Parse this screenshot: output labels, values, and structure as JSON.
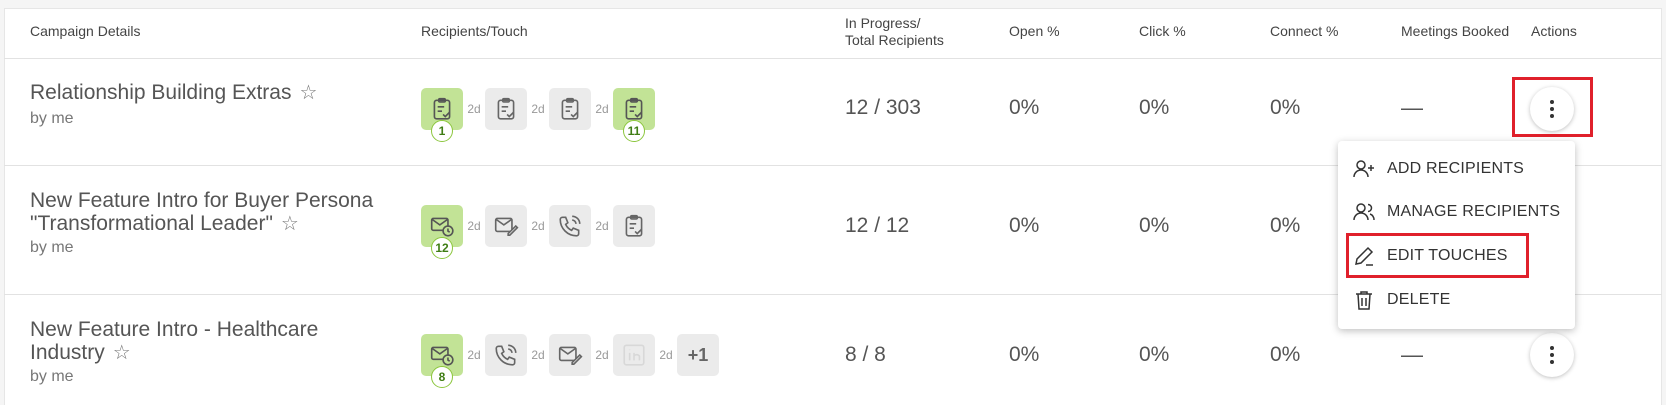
{
  "headers": {
    "campaign": "Campaign Details",
    "recipients_touch": "Recipients/Touch",
    "in_progress_line1": "In Progress/",
    "in_progress_line2": "Total Recipients",
    "open": "Open %",
    "click": "Click %",
    "connect": "Connect %",
    "meetings": "Meetings Booked",
    "actions": "Actions"
  },
  "rows": [
    {
      "name_line1": "Relationship Building Extras",
      "name_line2": "",
      "by": "by me",
      "star": "☆",
      "in_progress": "12 / 303",
      "open": "0%",
      "click": "0%",
      "connect": "0%",
      "meetings": "—",
      "touches": [
        {
          "icon": "clipboard-check-icon",
          "active": true,
          "count": "1"
        },
        {
          "icon": "clipboard-check-icon",
          "active": false,
          "count": ""
        },
        {
          "icon": "clipboard-check-icon",
          "active": false,
          "count": ""
        },
        {
          "icon": "clipboard-check-icon",
          "active": true,
          "count": "11"
        }
      ],
      "gaps": [
        "2d",
        "2d",
        "2d"
      ]
    },
    {
      "name_line1": "New Feature Intro for Buyer Persona",
      "name_line2": "\"Transformational Leader\"",
      "by": "by me",
      "star": "☆",
      "in_progress": "12 / 12",
      "open": "0%",
      "click": "0%",
      "connect": "0%",
      "meetings": "",
      "touches": [
        {
          "icon": "email-clock-icon",
          "active": true,
          "count": "12"
        },
        {
          "icon": "email-edit-icon",
          "active": false,
          "count": ""
        },
        {
          "icon": "phone-icon",
          "active": false,
          "count": ""
        },
        {
          "icon": "clipboard-check-icon",
          "active": false,
          "count": ""
        }
      ],
      "gaps": [
        "2d",
        "2d",
        "2d"
      ]
    },
    {
      "name_line1": "New Feature Intro - Healthcare",
      "name_line2": "Industry",
      "by": "by me",
      "star": "☆",
      "in_progress": "8 / 8",
      "open": "0%",
      "click": "0%",
      "connect": "0%",
      "meetings": "—",
      "touches": [
        {
          "icon": "email-clock-icon",
          "active": true,
          "count": "8"
        },
        {
          "icon": "phone-icon",
          "active": false,
          "count": ""
        },
        {
          "icon": "email-edit-icon",
          "active": false,
          "count": ""
        },
        {
          "icon": "linkedin-icon",
          "active": false,
          "count": ""
        }
      ],
      "gaps": [
        "2d",
        "2d",
        "2d",
        "2d"
      ],
      "more": "+1"
    }
  ],
  "menu": {
    "add_recipients": "ADD RECIPIENTS",
    "manage_recipients": "MANAGE RECIPIENTS",
    "edit_touches": "EDIT TOUCHES",
    "delete": "DELETE"
  },
  "colors": {
    "active_touch": "#c2e396",
    "inactive_touch": "#ebebeb",
    "highlight": "#e0202b",
    "count_border": "#8cc63e"
  }
}
